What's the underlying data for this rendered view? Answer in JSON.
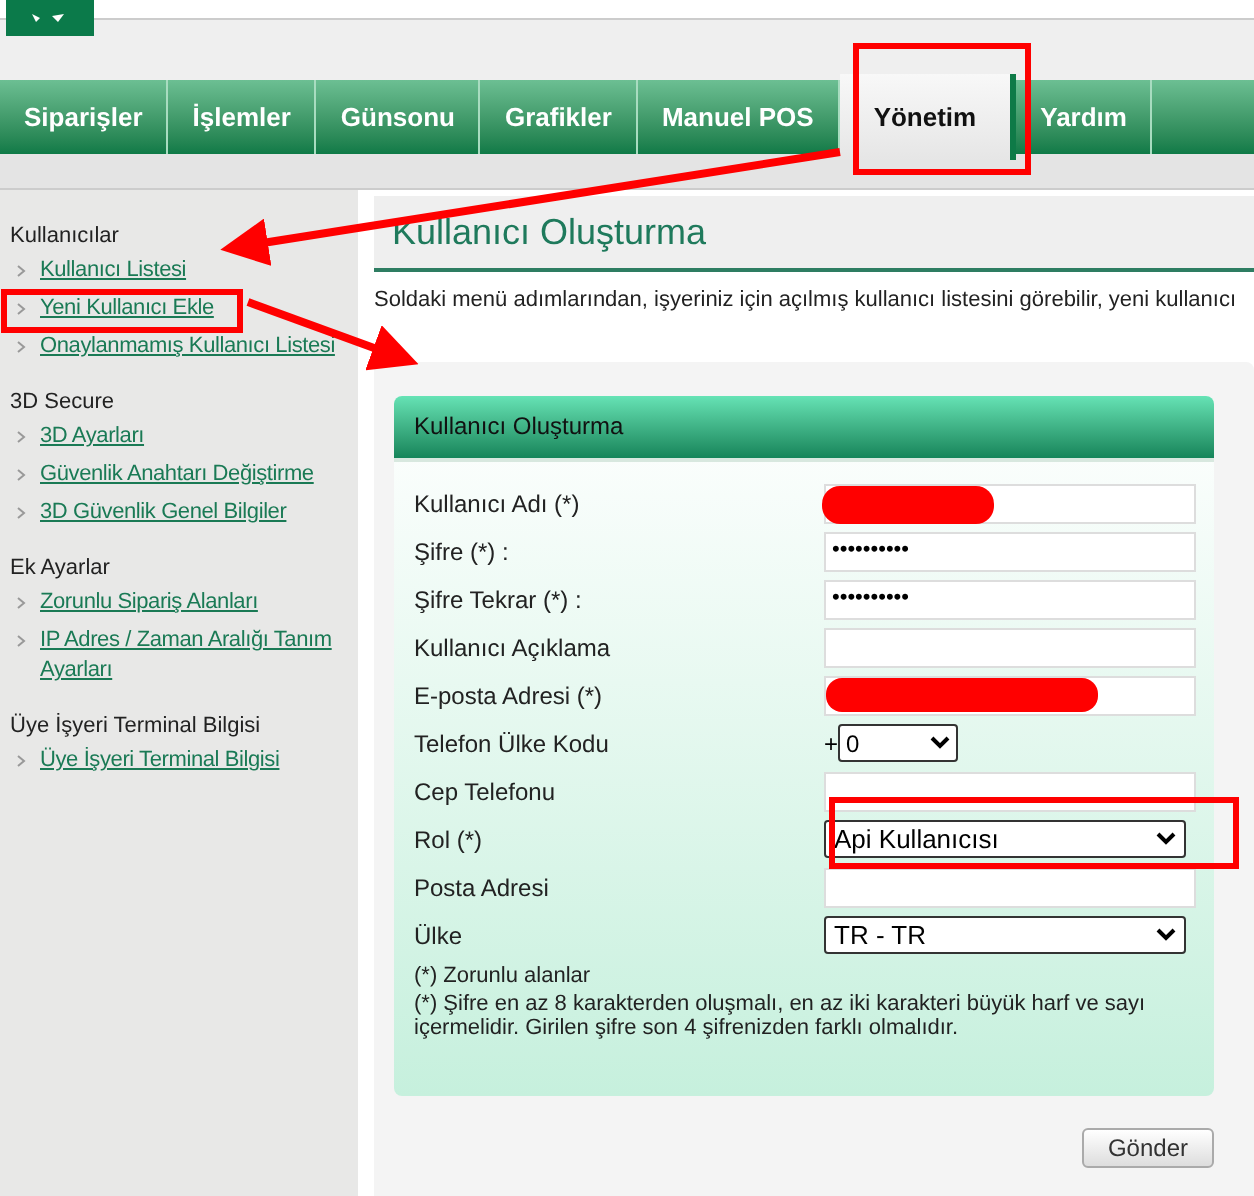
{
  "nav": {
    "tabs": [
      {
        "label": "Siparişler",
        "selected": false
      },
      {
        "label": "İşlemler",
        "selected": false
      },
      {
        "label": "Günsonu",
        "selected": false
      },
      {
        "label": "Grafikler",
        "selected": false
      },
      {
        "label": "Manuel POS",
        "selected": false
      },
      {
        "label": "Yönetim",
        "selected": true
      },
      {
        "label": "Yardım",
        "selected": false
      }
    ]
  },
  "sidebar": {
    "groups": [
      {
        "title": "Kullanıcılar",
        "items": [
          {
            "label": "Kullanıcı Listesi"
          },
          {
            "label": "Yeni Kullanıcı Ekle"
          },
          {
            "label": "Onaylanmamış Kullanıcı Listesi"
          }
        ]
      },
      {
        "title": "3D Secure",
        "items": [
          {
            "label": "3D Ayarları"
          },
          {
            "label": "Güvenlik Anahtarı Değiştirme"
          },
          {
            "label": "3D Güvenlik Genel Bilgiler"
          }
        ]
      },
      {
        "title": "Ek Ayarlar",
        "items": [
          {
            "label": "Zorunlu Sipariş Alanları"
          },
          {
            "label": "IP Adres / Zaman Aralığı Tanım Ayarları"
          }
        ]
      },
      {
        "title": "Üye İşyeri Terminal Bilgisi",
        "items": [
          {
            "label": "Üye İşyeri Terminal Bilgisi"
          }
        ]
      }
    ]
  },
  "page": {
    "title": "Kullanıcı Oluşturma",
    "description": "Soldaki menü adımlarından, işyeriniz için açılmış kullanıcı listesini görebilir, yeni kullanıcı"
  },
  "form": {
    "title": "Kullanıcı Oluşturma",
    "fields": [
      {
        "kind": "text",
        "label": "Kullanıcı Adı (*)",
        "redacted": true
      },
      {
        "kind": "text",
        "label": "Şifre (*) :",
        "value": "••••••••••"
      },
      {
        "kind": "text",
        "label": "Şifre Tekrar (*) :",
        "value": "••••••••••"
      },
      {
        "kind": "text",
        "label": "Kullanıcı Açıklama"
      },
      {
        "kind": "text",
        "label": "E-posta Adresi (*)",
        "redacted": true
      },
      {
        "kind": "phone",
        "label": "Telefon Ülke Kodu",
        "prefix": "+",
        "value": "0"
      },
      {
        "kind": "text",
        "label": "Cep Telefonu"
      },
      {
        "kind": "select",
        "label": "Rol (*)",
        "value": "Api Kullanıcısı"
      },
      {
        "kind": "text",
        "label": "Posta Adresi"
      },
      {
        "kind": "select",
        "label": "Ülke",
        "value": "TR - TR"
      }
    ],
    "notes": [
      "(*) Zorunlu alanlar",
      "(*) Şifre en az 8 karakterden oluşmalı, en az iki karakteri büyük harf ve sayı içermelidir. Girilen şifre son 4 şifrenizden farklı olmalıdır."
    ],
    "submit": "Gönder"
  }
}
